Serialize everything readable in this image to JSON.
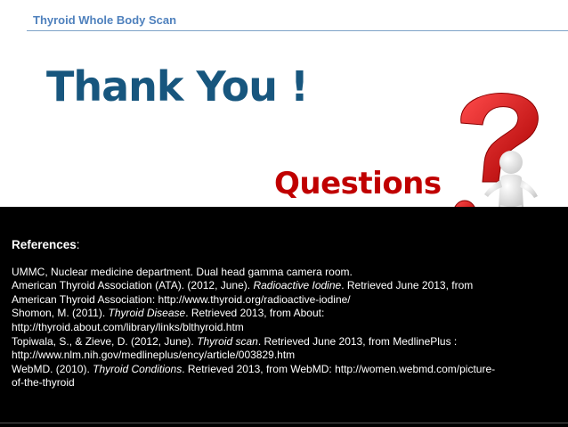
{
  "header": {
    "title": "Thyroid Whole Body Scan"
  },
  "main": {
    "thanks": "Thank You !",
    "questions": "Questions"
  },
  "references": {
    "heading": "References",
    "heading_colon": ":",
    "lines": [
      {
        "pre": "UMMC, Nuclear medicine department. Dual head gamma camera room.",
        "em": "",
        "post": ""
      },
      {
        "pre": "American Thyroid Association (ATA). (2012, June). ",
        "em": "Radioactive Iodine",
        "post": ". Retrieved June 2013, from"
      },
      {
        "pre": "American Thyroid Association: http://www.thyroid.org/radioactive-iodine/",
        "em": "",
        "post": ""
      },
      {
        "pre": "Shomon, M. (2011). ",
        "em": "Thyroid Disease",
        "post": ". Retrieved 2013, from About:"
      },
      {
        "pre": "http://thyroid.about.com/library/links/blthyroid.htm",
        "em": "",
        "post": ""
      },
      {
        "pre": "Topiwala, S., & Zieve, D. (2012, June). ",
        "em": "Thyroid scan",
        "post": ". Retrieved June 2013, from MedlinePlus :"
      },
      {
        "pre": "http://www.nlm.nih.gov/medlineplus/ency/article/003829.htm",
        "em": "",
        "post": ""
      },
      {
        "pre": "WebMD. (2010). ",
        "em": "Thyroid Conditions",
        "post": ". Retrieved 2013, from WebMD: http://women.webmd.com/picture-"
      },
      {
        "pre": "of-the-thyroid",
        "em": "",
        "post": ""
      }
    ]
  },
  "colors": {
    "header_title": "#4f81bd",
    "thanks": "#17567e",
    "questions": "#c00000",
    "question_mark": "#d11a1a",
    "background_band": "#000000"
  },
  "icons": {
    "illustration": "question-mark-figure-icon"
  }
}
